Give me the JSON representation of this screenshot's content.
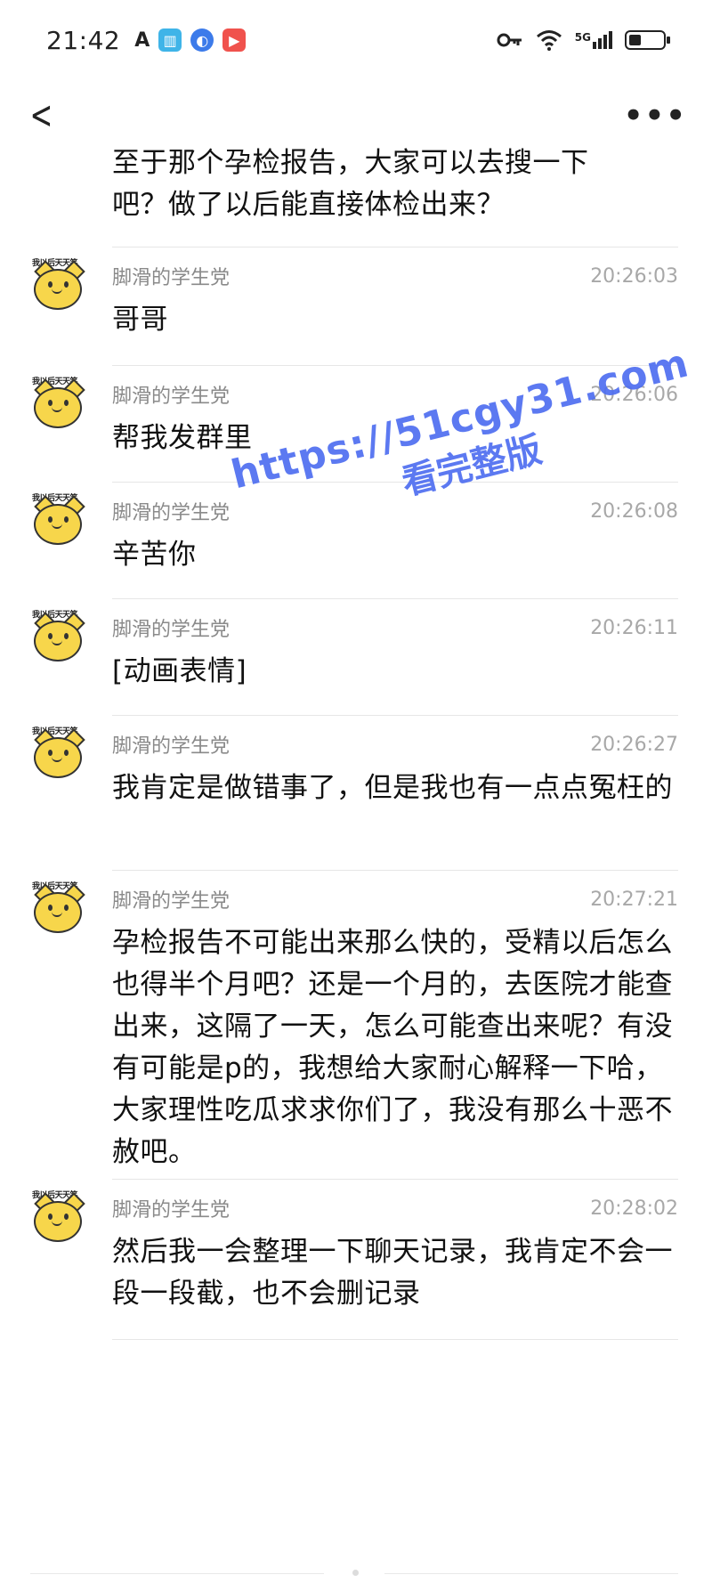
{
  "status_bar": {
    "time": "21:42",
    "apps": [
      "text-a-icon",
      "book-app-icon",
      "browser-app-icon",
      "video-app-icon"
    ],
    "signal_label": "5G",
    "icons": [
      "key-icon",
      "wifi-icon",
      "signal-icon",
      "battery-icon"
    ],
    "battery_level": 0.35
  },
  "nav": {
    "back_icon": "chevron-left-icon",
    "more_icon": "more-dots-icon"
  },
  "chat": {
    "partial_message": {
      "text": "至于那个孕检报告，大家可以去搜一下吧？做了以后能直接体检出来？"
    },
    "avatar_tag": "我以后天天笑",
    "messages": [
      {
        "sender": "脚滑的学生党",
        "time": "20:26:03",
        "text": "哥哥"
      },
      {
        "sender": "脚滑的学生党",
        "time": "20:26:06",
        "text": "帮我发群里"
      },
      {
        "sender": "脚滑的学生党",
        "time": "20:26:08",
        "text": "辛苦你"
      },
      {
        "sender": "脚滑的学生党",
        "time": "20:26:11",
        "text": "[动画表情]"
      },
      {
        "sender": "脚滑的学生党",
        "time": "20:26:27",
        "text": "我肯定是做错事了，但是我也有一点点冤枉的"
      },
      {
        "sender": "脚滑的学生党",
        "time": "20:27:21",
        "text": "孕检报告不可能出来那么快的，受精以后怎么也得半个月吧？还是一个月的，去医院才能查出来，这隔了一天，怎么可能查出来呢？有没有可能是p的，我想给大家耐心解释一下哈，大家理性吃瓜求求你们了，我没有那么十恶不赦吧。"
      },
      {
        "sender": "脚滑的学生党",
        "time": "20:28:02",
        "text": "然后我一会整理一下聊天记录，我肯定不会一段一段截，也不会删记录"
      }
    ]
  },
  "watermark": {
    "url": "https://51cgy31.com",
    "subtitle": "看完整版",
    "color": "#4f6ef0"
  }
}
